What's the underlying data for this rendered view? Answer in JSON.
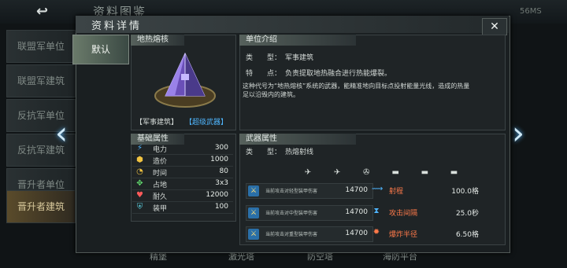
{
  "background": {
    "title": "资料图鉴",
    "top_right": "56MS",
    "nav_items": [
      "联盟军单位",
      "联盟军建筑",
      "反抗军单位",
      "反抗军建筑",
      "晋升者单位",
      "晋升者建筑"
    ],
    "bottom_tabs": [
      "精堡",
      "激光塔",
      "防空塔",
      "海防平台"
    ]
  },
  "panel": {
    "title": "资料详情",
    "close": "✕",
    "tab": "默认"
  },
  "unit": {
    "name": "地热熔核",
    "tag_type": "【军事建筑】",
    "tag_special": "【超级武器】",
    "intro_header": "单位介绍",
    "type_label": "类　　型：",
    "type_value": "军事建筑",
    "feature_label": "特　　点：",
    "feature_value": "负责提取地热融合进行热能爆裂。",
    "description_1": "这种代号为“地热熔核”系统的武器，能精准地向目标点投射能量光线，造成的热量",
    "description_2": "足以沿毁内的建筑。"
  },
  "base_stats": {
    "header": "基础属性",
    "rows": [
      {
        "label": "电力",
        "value": "300",
        "icon": "lightning-icon",
        "color": "#4fb6ff"
      },
      {
        "label": "造价",
        "value": "1000",
        "icon": "coin-icon",
        "color": "#f0c341"
      },
      {
        "label": "时间",
        "value": "80",
        "icon": "clock-icon",
        "color": "#f0c341"
      },
      {
        "label": "占地",
        "value": "3x3",
        "icon": "grid-icon",
        "color": "#5fd36b"
      },
      {
        "label": "耐久",
        "value": "12000",
        "icon": "heart-icon",
        "color": "#ff5a5a"
      },
      {
        "label": "装甲",
        "value": "100",
        "icon": "shield-icon",
        "color": "#59c9d8"
      }
    ]
  },
  "weapon": {
    "header": "武器属性",
    "type_label": "类　　型：",
    "type_value": "热熔射线",
    "target_icons": [
      "✈",
      "✈",
      "✇",
      "▬",
      "▬",
      "▬"
    ],
    "damage": [
      {
        "label": "当前攻击对轻型装甲伤害",
        "value": "14700"
      },
      {
        "label": "当前攻击对中型装甲伤害",
        "value": "14700"
      },
      {
        "label": "当前攻击对重型装甲伤害",
        "value": "14700"
      }
    ],
    "stats": [
      {
        "label": "射程",
        "value": "100.0格",
        "icon": "range-icon"
      },
      {
        "label": "攻击间隔",
        "value": "25.0秒",
        "icon": "hourglass-icon"
      },
      {
        "label": "爆炸半径",
        "value": "6.50格",
        "icon": "explosion-icon"
      }
    ]
  }
}
